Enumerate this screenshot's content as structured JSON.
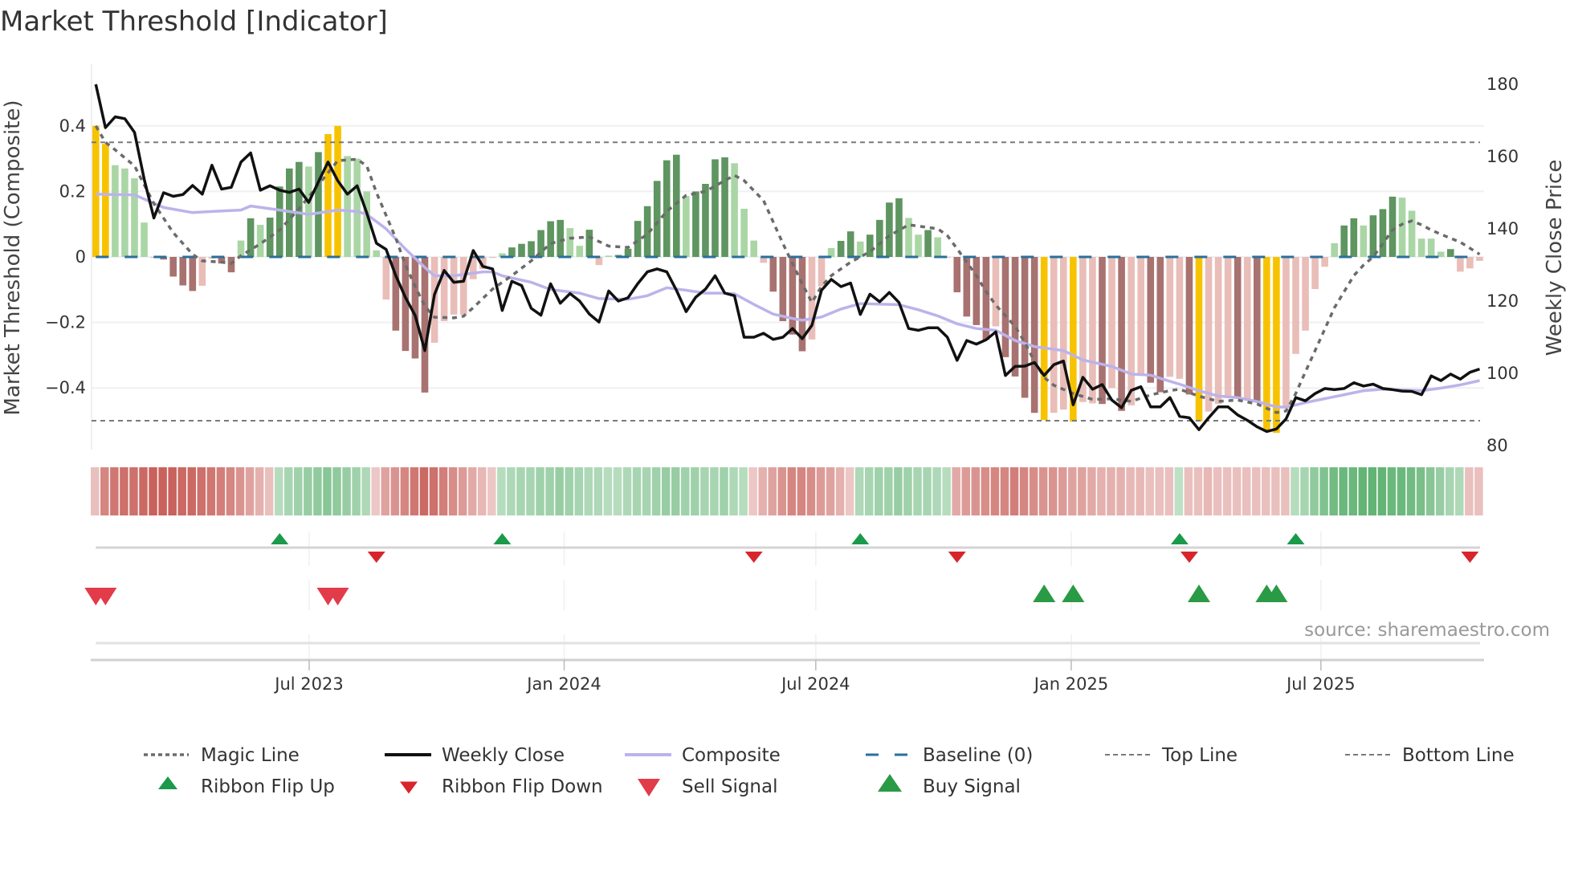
{
  "chart_data": {
    "type": "bar",
    "title": "Market Threshold [Indicator]",
    "ylabel": "Market Threshold (Composite)",
    "y2label": "Weekly Close Price",
    "source": "source: sharemaestro.com",
    "ylim": [
      -0.58,
      0.58
    ],
    "y2lim": [
      78,
      184
    ],
    "yticks": [
      {
        "v": 0.4,
        "label": "0.4"
      },
      {
        "v": 0.2,
        "label": "0.2"
      },
      {
        "v": 0,
        "label": "0"
      },
      {
        "v": -0.2,
        "label": "−0.2"
      },
      {
        "v": -0.4,
        "label": "−0.4"
      }
    ],
    "y2ticks": [
      {
        "v": 180,
        "label": "180"
      },
      {
        "v": 160,
        "label": "160"
      },
      {
        "v": 140,
        "label": "140"
      },
      {
        "v": 120,
        "label": "120"
      },
      {
        "v": 100,
        "label": "100"
      },
      {
        "v": 80,
        "label": "80"
      }
    ],
    "xticks": [
      {
        "x": 22.05,
        "label": "Jul 2023"
      },
      {
        "x": 48.4,
        "label": "Jan 2024"
      },
      {
        "x": 74.4,
        "label": "Jul 2024"
      },
      {
        "x": 100.8,
        "label": "Jan 2025"
      },
      {
        "x": 126.6,
        "label": "Jul 2025"
      }
    ],
    "top_line": 0.35,
    "bottom_line": -0.5,
    "baseline": 0,
    "composite_bars": [
      0.4,
      0.345,
      0.28,
      0.27,
      0.24,
      0.105,
      -0.003,
      -0.008,
      -0.06,
      -0.087,
      -0.104,
      -0.088,
      -0.005,
      -0.02,
      -0.047,
      0.05,
      0.118,
      0.098,
      0.12,
      0.215,
      0.27,
      0.29,
      0.276,
      0.32,
      0.375,
      0.4,
      0.308,
      0.3,
      0.2,
      0.02,
      -0.13,
      -0.225,
      -0.287,
      -0.31,
      -0.414,
      -0.262,
      -0.196,
      -0.176,
      -0.176,
      -0.068,
      -0.037,
      -0.003,
      0.011,
      0.029,
      0.04,
      0.048,
      0.082,
      0.109,
      0.113,
      0.088,
      0.034,
      0.083,
      -0.025,
      0.004,
      0.006,
      0.025,
      0.11,
      0.155,
      0.232,
      0.295,
      0.312,
      0.186,
      0.2,
      0.223,
      0.298,
      0.304,
      0.286,
      0.147,
      0.05,
      -0.018,
      -0.106,
      -0.196,
      -0.237,
      -0.288,
      -0.252,
      -0.09,
      0.027,
      0.049,
      0.078,
      0.047,
      0.068,
      0.113,
      0.166,
      0.179,
      0.119,
      0.068,
      0.082,
      0.06,
      -0.002,
      -0.108,
      -0.182,
      -0.208,
      -0.253,
      -0.212,
      -0.306,
      -0.365,
      -0.43,
      -0.476,
      -0.498,
      -0.476,
      -0.466,
      -0.503,
      -0.443,
      -0.447,
      -0.449,
      -0.4,
      -0.47,
      -0.453,
      -0.36,
      -0.384,
      -0.413,
      -0.366,
      -0.372,
      -0.42,
      -0.502,
      -0.472,
      -0.449,
      -0.425,
      -0.429,
      -0.433,
      -0.441,
      -0.531,
      -0.537,
      -0.458,
      -0.296,
      -0.225,
      -0.098,
      -0.03,
      0.042,
      0.096,
      0.118,
      0.096,
      0.127,
      0.146,
      0.184,
      0.181,
      0.141,
      0.056,
      0.056,
      0.016,
      0.024,
      -0.045,
      -0.035,
      -0.012
    ],
    "bar_classes": "YYggggrRRRRrrRRgGgGGGGgGYYggggrRRRRrrrrrrrgGGGGGGggGrgGGGGGGGgGGGGgggrRRRRrrgGGgGGGGggGgrRRRRrRRRRYrrYrrRrRrrRRrrRYrrrRrRYYrrrrrgGGgGGGgggggGrrr",
    "bar_colors": {
      "Y": "#f7c300",
      "G": "#5e9560",
      "g": "#aad6a5",
      "R": "#a87270",
      "r": "#e9bdb8"
    },
    "weekly_close": [
      180,
      168,
      171,
      170.5,
      166.7,
      153.7,
      143,
      150,
      149,
      149.5,
      152,
      149.6,
      157.6,
      151,
      151.5,
      158.5,
      161,
      150.7,
      151.9,
      150.7,
      150.1,
      151,
      147.3,
      153,
      158.5,
      153.3,
      149.6,
      151.9,
      144.4,
      136,
      134.3,
      127,
      121,
      116,
      106.3,
      121.8,
      128.5,
      125.2,
      125.5,
      134,
      129.6,
      128.9,
      117.4,
      125.5,
      124.3,
      118,
      116.1,
      124.8,
      119.4,
      122.1,
      120,
      116.4,
      114.2,
      122.8,
      120,
      120.9,
      124.8,
      128.1,
      128.9,
      128.1,
      123,
      117.1,
      121.1,
      123.3,
      127,
      122.2,
      121.5,
      110,
      110,
      111.1,
      109.4,
      110,
      112.4,
      109.6,
      113.3,
      123,
      126,
      124,
      125,
      116.3,
      121.9,
      119.8,
      122.4,
      119.6,
      112.4,
      111.9,
      112.6,
      112.6,
      110,
      103.6,
      109.1,
      108.1,
      109.3,
      111.5,
      99.4,
      101.9,
      102,
      103,
      99.4,
      102.4,
      103.4,
      91.3,
      98.9,
      95.6,
      96.9,
      92.6,
      90.5,
      95.3,
      96.3,
      90.7,
      90.7,
      93.3,
      88.1,
      87.7,
      84.4,
      87.7,
      90.7,
      90.7,
      88.5,
      87,
      85.2,
      83.9,
      84.6,
      87.4,
      93.3,
      92.4,
      94.4,
      95.8,
      95.5,
      95.8,
      97.4,
      96.5,
      97,
      95.8,
      95.5,
      95.1,
      95,
      94.1,
      99.3,
      98,
      99.8,
      98.4,
      100.3,
      101.2
    ],
    "composite_line": [
      [
        0,
        149.6
      ],
      [
        4,
        149.4
      ],
      [
        7,
        145.9
      ],
      [
        10,
        144.5
      ],
      [
        12,
        144.8
      ],
      [
        15,
        145.2
      ],
      [
        16,
        146.3
      ],
      [
        19,
        145.2
      ],
      [
        22,
        144
      ],
      [
        25,
        145.2
      ],
      [
        27,
        144.8
      ],
      [
        28,
        144
      ],
      [
        30,
        140
      ],
      [
        32,
        134.4
      ],
      [
        34,
        129.3
      ],
      [
        35,
        127
      ],
      [
        37,
        127
      ],
      [
        40,
        128.1
      ],
      [
        41,
        128.1
      ],
      [
        42,
        127
      ],
      [
        45,
        125.2
      ],
      [
        47,
        123.2
      ],
      [
        50,
        122.2
      ],
      [
        52,
        120.7
      ],
      [
        55,
        120.5
      ],
      [
        57,
        121.5
      ],
      [
        59,
        123.7
      ],
      [
        61,
        123
      ],
      [
        63,
        122.2
      ],
      [
        65,
        122.2
      ],
      [
        66,
        122
      ],
      [
        68,
        119.1
      ],
      [
        70,
        116.4
      ],
      [
        72,
        115.2
      ],
      [
        73,
        114.7
      ],
      [
        75,
        115.6
      ],
      [
        77,
        117.8
      ],
      [
        79,
        119.3
      ],
      [
        83,
        119
      ],
      [
        85,
        117.6
      ],
      [
        87,
        115.9
      ],
      [
        89,
        113.7
      ],
      [
        91,
        112.4
      ],
      [
        93,
        111.9
      ],
      [
        95,
        109.1
      ],
      [
        97,
        107.4
      ],
      [
        100,
        106.3
      ],
      [
        102,
        103.7
      ],
      [
        105,
        101.9
      ],
      [
        107,
        99.8
      ],
      [
        109,
        99.5
      ],
      [
        111,
        97.8
      ],
      [
        112,
        97
      ],
      [
        114,
        95.2
      ],
      [
        116,
        93.7
      ],
      [
        118,
        93.3
      ],
      [
        120,
        92.2
      ],
      [
        122,
        90.7
      ],
      [
        123,
        90.6
      ],
      [
        125,
        91.9
      ],
      [
        127,
        93
      ],
      [
        129,
        94.1
      ],
      [
        131,
        95.2
      ],
      [
        133,
        95.6
      ],
      [
        135,
        95.4
      ],
      [
        137,
        95.2
      ],
      [
        139,
        95.9
      ],
      [
        141,
        96.8
      ],
      [
        143,
        98
      ]
    ],
    "magic_line": [
      [
        0,
        0.4
      ],
      [
        1,
        0.35
      ],
      [
        2,
        0.327
      ],
      [
        4,
        0.278
      ],
      [
        6,
        0.163
      ],
      [
        8,
        0.074
      ],
      [
        10,
        0.008
      ],
      [
        11,
        -0.012
      ],
      [
        13,
        -0.016
      ],
      [
        14,
        -0.02
      ],
      [
        15,
        0.004
      ],
      [
        17,
        0.04
      ],
      [
        19,
        0.082
      ],
      [
        21,
        0.147
      ],
      [
        23,
        0.22
      ],
      [
        25,
        0.294
      ],
      [
        27,
        0.298
      ],
      [
        28,
        0.278
      ],
      [
        29,
        0.196
      ],
      [
        31,
        0.057
      ],
      [
        32,
        -0.025
      ],
      [
        33,
        -0.09
      ],
      [
        34,
        -0.15
      ],
      [
        35,
        -0.184
      ],
      [
        37,
        -0.186
      ],
      [
        38,
        -0.181
      ],
      [
        39,
        -0.155
      ],
      [
        41,
        -0.098
      ],
      [
        43,
        -0.057
      ],
      [
        45,
        -0.012
      ],
      [
        47,
        0.041
      ],
      [
        49,
        0.057
      ],
      [
        51,
        0.061
      ],
      [
        53,
        0.033
      ],
      [
        55,
        0.029
      ],
      [
        57,
        0.069
      ],
      [
        59,
        0.139
      ],
      [
        61,
        0.188
      ],
      [
        63,
        0.2
      ],
      [
        65,
        0.233
      ],
      [
        66,
        0.249
      ],
      [
        67,
        0.233
      ],
      [
        69,
        0.172
      ],
      [
        71,
        0.041
      ],
      [
        73,
        -0.082
      ],
      [
        74,
        -0.139
      ],
      [
        75,
        -0.09
      ],
      [
        76,
        -0.057
      ],
      [
        78,
        -0.016
      ],
      [
        80,
        0.016
      ],
      [
        82,
        0.065
      ],
      [
        84,
        0.098
      ],
      [
        86,
        0.09
      ],
      [
        87,
        0.086
      ],
      [
        88,
        0.065
      ],
      [
        89,
        0.025
      ],
      [
        90,
        -0.016
      ],
      [
        91,
        -0.057
      ],
      [
        92,
        -0.106
      ],
      [
        93,
        -0.147
      ],
      [
        95,
        -0.212
      ],
      [
        96,
        -0.261
      ],
      [
        97,
        -0.319
      ],
      [
        98,
        -0.368
      ],
      [
        99,
        -0.392
      ],
      [
        101,
        -0.417
      ],
      [
        103,
        -0.435
      ],
      [
        105,
        -0.433
      ],
      [
        107,
        -0.441
      ],
      [
        109,
        -0.421
      ],
      [
        111,
        -0.408
      ],
      [
        112,
        -0.404
      ],
      [
        114,
        -0.425
      ],
      [
        116,
        -0.441
      ],
      [
        118,
        -0.437
      ],
      [
        120,
        -0.449
      ],
      [
        122,
        -0.475
      ],
      [
        123,
        -0.47
      ],
      [
        124,
        -0.417
      ],
      [
        125,
        -0.351
      ],
      [
        126,
        -0.286
      ],
      [
        127,
        -0.22
      ],
      [
        128,
        -0.155
      ],
      [
        129,
        -0.106
      ],
      [
        130,
        -0.057
      ],
      [
        131,
        -0.025
      ],
      [
        132,
        0
      ],
      [
        133,
        0.041
      ],
      [
        134,
        0.082
      ],
      [
        135,
        0.1
      ],
      [
        136,
        0.11
      ],
      [
        137,
        0.098
      ],
      [
        138,
        0.082
      ],
      [
        139,
        0.069
      ],
      [
        141,
        0.045
      ],
      [
        143,
        0.008
      ]
    ],
    "ribbon": [
      -0.2,
      -0.6,
      -0.7,
      -0.75,
      -0.75,
      -0.8,
      -0.85,
      -0.85,
      -0.85,
      -0.8,
      -0.8,
      -0.75,
      -0.7,
      -0.65,
      -0.6,
      -0.5,
      -0.4,
      -0.3,
      -0.2,
      0.25,
      0.35,
      0.4,
      0.45,
      0.5,
      0.55,
      0.5,
      0.45,
      0.4,
      0.3,
      -0.15,
      -0.4,
      -0.5,
      -0.6,
      -0.7,
      -0.8,
      -0.75,
      -0.65,
      -0.55,
      -0.45,
      -0.35,
      -0.25,
      -0.15,
      0.25,
      0.3,
      0.35,
      0.35,
      0.4,
      0.4,
      0.45,
      0.4,
      0.35,
      0.3,
      0.3,
      0.25,
      0.25,
      0.3,
      0.35,
      0.35,
      0.4,
      0.45,
      0.45,
      0.4,
      0.4,
      0.35,
      0.35,
      0.4,
      0.3,
      0.25,
      -0.15,
      -0.3,
      -0.4,
      -0.5,
      -0.6,
      -0.6,
      -0.55,
      -0.45,
      -0.4,
      -0.3,
      -0.15,
      0.3,
      0.35,
      0.4,
      0.4,
      0.45,
      0.4,
      0.35,
      0.35,
      0.3,
      0.25,
      -0.35,
      -0.45,
      -0.5,
      -0.55,
      -0.6,
      -0.6,
      -0.65,
      -0.6,
      -0.55,
      -0.5,
      -0.5,
      -0.45,
      -0.4,
      -0.4,
      -0.35,
      -0.3,
      -0.3,
      -0.3,
      -0.25,
      -0.25,
      -0.2,
      -0.2,
      -0.2,
      0.2,
      -0.2,
      -0.2,
      -0.25,
      -0.2,
      -0.2,
      -0.2,
      -0.2,
      -0.2,
      -0.2,
      -0.2,
      -0.2,
      0.25,
      0.35,
      0.5,
      0.6,
      0.7,
      0.75,
      0.75,
      0.8,
      0.8,
      0.8,
      0.75,
      0.75,
      0.7,
      0.65,
      0.55,
      0.45,
      0.35,
      0.3,
      -0.2,
      -0.2
    ],
    "ribbon_flip_up": [
      19,
      42,
      79,
      112,
      124
    ],
    "ribbon_flip_down": [
      29,
      68,
      89,
      113,
      142
    ],
    "sell_signals": [
      0,
      1,
      24,
      25
    ],
    "buy_signals": [
      98,
      101,
      114,
      121,
      122
    ],
    "colors": {
      "close": "#111111",
      "composite": "#bcb3ea",
      "magic": "#6b6b6b",
      "baseline": "#2a6f9b",
      "guides": "#7a7a7a",
      "flip_up": "#1a9a4a",
      "flip_down": "#d7262b",
      "sell": "#e23b4a",
      "buy": "#2a9a45"
    },
    "legend": {
      "position": "bottom",
      "items": [
        {
          "label": "Magic Line",
          "kind": "dotted"
        },
        {
          "label": "Weekly Close",
          "kind": "solid-black"
        },
        {
          "label": "Composite",
          "kind": "solid-lavender"
        },
        {
          "label": "Baseline (0)",
          "kind": "dashed-blue"
        },
        {
          "label": "Top Line",
          "kind": "dashed-grey"
        },
        {
          "label": "Bottom Line",
          "kind": "dashed-grey"
        },
        {
          "label": "Ribbon Flip Up",
          "kind": "tri-up-small"
        },
        {
          "label": "Ribbon Flip Down",
          "kind": "tri-down-small"
        },
        {
          "label": "Sell Signal",
          "kind": "tri-down-big"
        },
        {
          "label": "Buy Signal",
          "kind": "tri-up-big"
        }
      ]
    }
  }
}
